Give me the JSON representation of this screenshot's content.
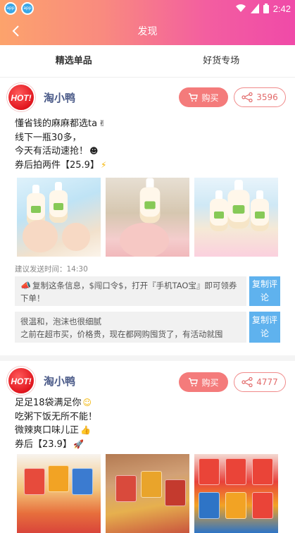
{
  "status_bar": {
    "time": "2:42",
    "app_icons": [
      "app-icon",
      "app-icon"
    ]
  },
  "nav": {
    "title": "发现",
    "back_icon": "chevron-left-icon"
  },
  "tabs": [
    {
      "label": "精选单品",
      "active": true
    },
    {
      "label": "好货专场",
      "active": false
    }
  ],
  "colors": {
    "header_start": "#fca36c",
    "header_end": "#f04aa8",
    "buy": "#f47b7b",
    "copy": "#5fb2ee",
    "shop": "#4a5a88"
  },
  "posts": [
    {
      "shop": "淘小鸭",
      "avatar_text": "HOT!",
      "buy_label": "购买",
      "share_count": "3596",
      "lines": [
        "懂省钱的麻麻都选ta",
        "线下一瓶30多，",
        "今天有活动速抢！",
        "券后拍两件【25.9】"
      ],
      "emojis": [
        "victory-hand-icon",
        "",
        "face-icon",
        "lightning-icon"
      ],
      "suggest_time": "建议发送时间：14:30",
      "copy_blocks": [
        {
          "text": "复制这条信息，$闯口令$，打开『手机TAO宝』即可领券下单！",
          "icon": "megaphone-icon",
          "button": "复制评论"
        },
        {
          "text": "很温和，泡沫也很细腻\n之前在超市买，价格贵，现在都网购囤货了，有活动就囤",
          "icon": "",
          "button": "复制评论"
        }
      ]
    },
    {
      "shop": "淘小鸭",
      "avatar_text": "HOT!",
      "buy_label": "购买",
      "share_count": "4777",
      "lines": [
        "足足18袋满足你",
        "吃粥下饭无所不能！",
        "微辣爽口味儿正",
        "券后【23.9】"
      ],
      "emojis": [
        "smile-icon",
        "",
        "thumbs-up-icon",
        "rocket-icon"
      ]
    }
  ]
}
